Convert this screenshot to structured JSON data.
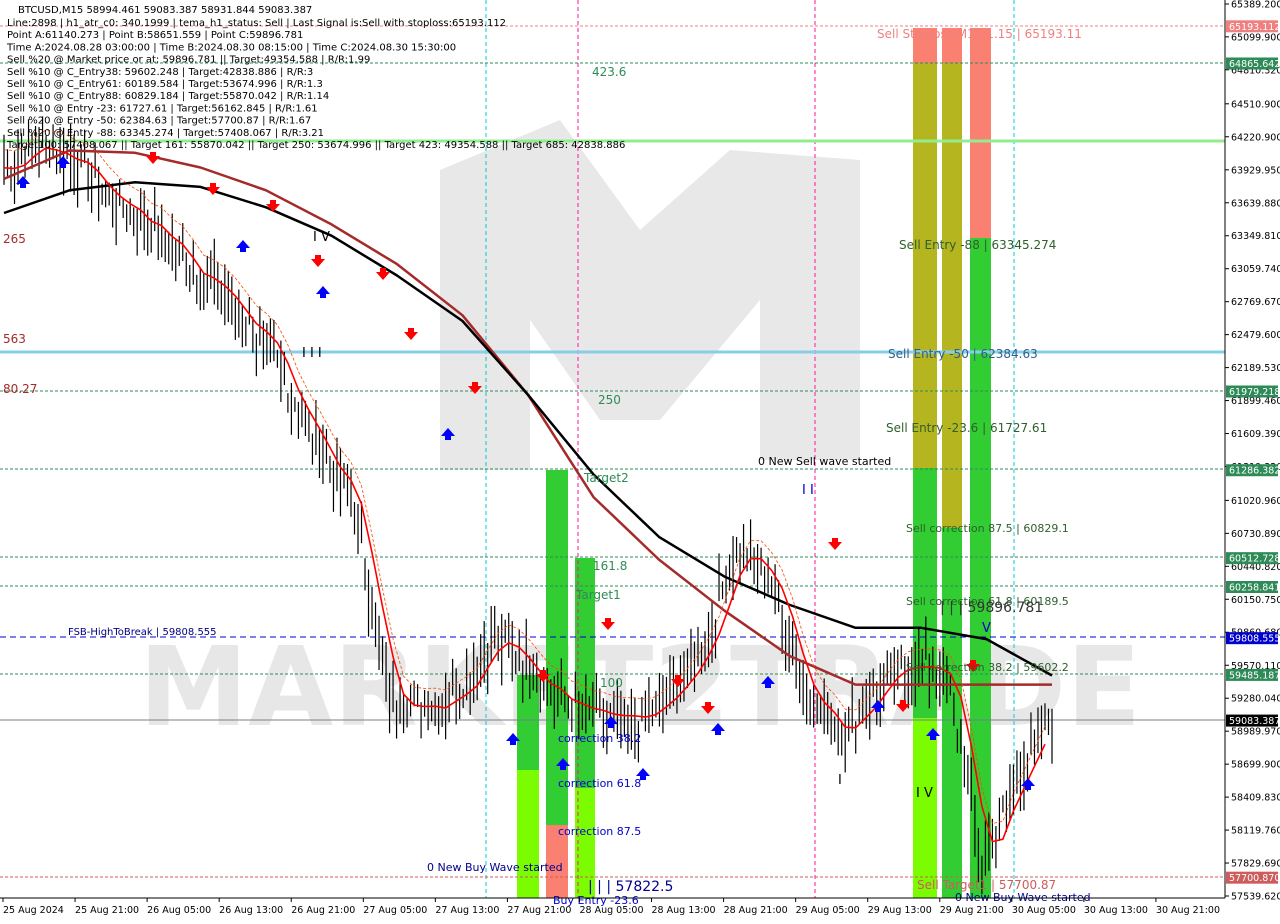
{
  "header": {
    "symbol_line": "BTCUSD,M15  58994.461 59083.387 58931.844 59083.387",
    "info_lines": [
      "Line:2898 | h1_atr_c0: 340.1999 | tema_h1_status: Sell | Last Signal is:Sell with stoploss:65193.112",
      "Point A:61140.273 | Point B:58651.559 | Point C:59896.781",
      "Time A:2024.08.28 03:00:00 | Time B:2024.08.30 08:15:00 | Time C:2024.08.30 15:30:00",
      "Sell %20 @ Market price or at: 59896.781 || Target:49354.588 | R/R:1.99",
      "Sell %10 @ C_Entry38: 59602.248 | Target:42838.886 | R/R:3",
      "Sell %10 @ C_Entry61: 60189.584 | Target:53674.996 | R/R:1.3",
      "Sell %10 @ C_Entry88: 60829.184 | Target:55870.042 | R/R:1.14",
      "Sell %10 @ Entry -23: 61727.61 | Target:56162.845 | R/R:1.61",
      "Sell %20 @ Entry -50: 62384.63 | Target:57700.87 | R/R:1.67",
      "Sell %20 @ Entry -88: 63345.274 | Target:57408.067 | R/R:3.21",
      "Target100: 57408.067 || Target 161: 55870.042 || Target 250: 53674.996 || Target 423: 49354.588 || Target 685: 42838.886"
    ]
  },
  "watermark": "MARKET2TRADE",
  "price_axis": {
    "ticks": [
      "65389.200",
      "65099.900",
      "64810.320",
      "64510.900",
      "64220.900",
      "63929.950",
      "63639.880",
      "63349.810",
      "63059.740",
      "62769.670",
      "62479.600",
      "62189.530",
      "61899.460",
      "61609.390",
      "61319.320",
      "61020.960",
      "60730.890",
      "60440.820",
      "60150.750",
      "59860.680",
      "59570.110",
      "59280.040",
      "58989.970",
      "58699.900",
      "58409.830",
      "58119.760",
      "57829.690",
      "57539.620"
    ],
    "markers": [
      {
        "text": "65193.112",
        "color": "#f08080",
        "text_color": "#ffffff"
      },
      {
        "text": "64865.642",
        "color": "#2e8b57",
        "text_color": "#ffffff"
      },
      {
        "text": "61979.218",
        "color": "#2e8b57",
        "text_color": "#ffffff"
      },
      {
        "text": "61286.382",
        "color": "#2e8b57",
        "text_color": "#ffffff"
      },
      {
        "text": "60512.728",
        "color": "#2e8b57",
        "text_color": "#ffffff"
      },
      {
        "text": "60258.841",
        "color": "#2e8b57",
        "text_color": "#ffffff"
      },
      {
        "text": "59808.555",
        "color": "#0000cd",
        "text_color": "#ffffff"
      },
      {
        "text": "59485.187",
        "color": "#2e8b57",
        "text_color": "#ffffff"
      },
      {
        "text": "59083.387",
        "color": "#000000",
        "text_color": "#ffffff"
      },
      {
        "text": "57700.870",
        "color": "#cd5c5c",
        "text_color": "#ffffff"
      }
    ]
  },
  "time_axis": [
    "25 Aug 2024",
    "25 Aug 21:00",
    "26 Aug 05:00",
    "26 Aug 13:00",
    "26 Aug 21:00",
    "27 Aug 05:00",
    "27 Aug 13:00",
    "27 Aug 21:00",
    "28 Aug 05:00",
    "28 Aug 13:00",
    "28 Aug 21:00",
    "29 Aug 05:00",
    "29 Aug 13:00",
    "29 Aug 21:00",
    "30 Aug 05:00",
    "30 Aug 13:00",
    "30 Aug 21:00"
  ],
  "annotations": {
    "stoploss": "Sell Stoploss M15 1.15 | 65193.11",
    "entry_88": "Sell Entry -88 | 63345.274",
    "entry_50": "Sell Entry -50 | 62384.63",
    "entry_23": "Sell Entry -23.6 | 61727.61",
    "corr_875": "Sell correction 87.5 | 60829.1",
    "corr_618": "Sell correction 61.8 | 60189.5",
    "corr_382": "Sell correction 38.2 | 59602.2",
    "target1_sell": "Sell Target1 | 57700.87",
    "new_sell_wave": "0 New Sell wave started",
    "new_buy_wave_1": "0 New Buy Wave started",
    "new_buy_wave_2": "0 New Buy Wave started",
    "point_c": "| | | 59896.781",
    "point_57822": "| | | 57822.5",
    "point_64": "| | | 64? ??4?",
    "fsb": "FSB-HighToBreak | 59808.555",
    "lvl_4236": "423.6",
    "lvl_250": "250",
    "lvl_target2": "Target2",
    "lvl_1618": "161.8",
    "lvl_target1": "Target1",
    "lvl_100": "100",
    "corr_382_buy": "correction 38.2",
    "corr_618_buy": "correction 61.8",
    "corr_875_buy": "correction 87.5",
    "buy_entry": "Buy Entry -23.6",
    "wave_iv_top": "I V",
    "wave_iii": "I I I",
    "wave_ii": "I I",
    "wave_iv_bottom": "I V",
    "wave_v": "V",
    "wave_i": "I",
    "left_265": "265",
    "left_563": "563",
    "left_8027": "80.27"
  },
  "colors": {
    "green_line": "#90ee90",
    "blue_line": "#87ceeb",
    "dashed_green": "#2e8b57",
    "stoploss": "#f08080",
    "ma_black": "#000000",
    "ma_dark_red": "#a52a2a",
    "ma_red": "#ff0000",
    "zone_green": "#32cd32",
    "zone_lime": "#7cfc00",
    "zone_red": "#fa8072",
    "zone_olive": "#b5b520",
    "magenta": "#ff1493",
    "cyan": "#00ced1"
  },
  "chart_data": {
    "type": "candlestick",
    "symbol": "BTCUSD",
    "timeframe": "M15",
    "ohlc_last": {
      "open": 58994.461,
      "high": 59083.387,
      "low": 58931.844,
      "close": 59083.387
    },
    "ylim": [
      57539.62,
      65389.2
    ],
    "x": [
      "25 Aug 2024",
      "25 Aug 21:00",
      "26 Aug 05:00",
      "26 Aug 13:00",
      "26 Aug 21:00",
      "27 Aug 05:00",
      "27 Aug 13:00",
      "27 Aug 21:00",
      "28 Aug 05:00",
      "28 Aug 13:00",
      "28 Aug 21:00",
      "29 Aug 05:00",
      "29 Aug 13:00",
      "29 Aug 21:00",
      "30 Aug 05:00",
      "30 Aug 13:00",
      "30 Aug 21:00"
    ],
    "close_path": [
      63950,
      64150,
      64050,
      63700,
      63500,
      63200,
      62900,
      62600,
      62100,
      61500,
      61000,
      59300,
      59200,
      59350,
      59800,
      59600,
      59250,
      59100,
      59050,
      59250,
      59700,
      60600,
      60300,
      59300,
      59000,
      59350,
      59600,
      59500,
      57800,
      58600,
      59083
    ],
    "ma_black": [
      63550,
      63750,
      63820,
      63780,
      63600,
      63350,
      63000,
      62600,
      61950,
      61250,
      60700,
      60350,
      60100,
      59900,
      59900,
      59800,
      59480
    ],
    "ma_dark_red": [
      63850,
      64100,
      64080,
      63950,
      63750,
      63450,
      63100,
      62650,
      61950,
      61050,
      60500,
      60050,
      59650,
      59400,
      59400,
      59400,
      59400
    ],
    "levels": [
      {
        "name": "Sell Stoploss",
        "value": 65193.112
      },
      {
        "name": "Sell Entry -88",
        "value": 63345.274
      },
      {
        "name": "Sell Entry -50",
        "value": 62384.63
      },
      {
        "name": "Sell Entry -23.6",
        "value": 61727.61
      },
      {
        "name": "FSB-HighToBreak",
        "value": 59808.555
      },
      {
        "name": "Sell Target1",
        "value": 57700.87
      }
    ]
  }
}
